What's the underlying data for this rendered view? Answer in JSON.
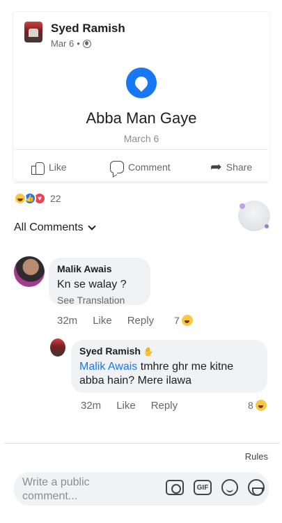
{
  "post": {
    "author": "Syed Ramish",
    "date": "Mar 6",
    "separator": "•",
    "event_title": "Abba Man Gaye",
    "event_date": "March 6"
  },
  "actions": {
    "like": "Like",
    "comment": "Comment",
    "share": "Share"
  },
  "reactions": {
    "count": "22",
    "types": [
      "haha",
      "like",
      "love"
    ]
  },
  "comments_filter": {
    "label": "All Comments"
  },
  "comments": [
    {
      "author": "Malik Awais",
      "text": "Kn se walay ?",
      "translate": "See Translation",
      "time": "32m",
      "like": "Like",
      "reply": "Reply",
      "reaction_count": "7"
    },
    {
      "author": "Syed Ramish",
      "mention": "Malik Awais",
      "text": " tmhre ghr me kitne abba hain? Mere ilawa",
      "time": "32m",
      "like": "Like",
      "reply": "Reply",
      "reaction_count": "8"
    }
  ],
  "footer": {
    "rules": "Rules",
    "composer_placeholder": "Write a public comment...",
    "gif_label": "GIF"
  },
  "icons": {
    "globe": "globe-icon",
    "life_event": "heart-badge-icon",
    "like": "thumbs-up-icon",
    "comment": "comment-icon",
    "share": "share-arrow-icon",
    "camera": "camera-icon",
    "gif": "gif-icon",
    "emoji": "smile-icon",
    "sticker": "sticker-icon"
  },
  "colors": {
    "accent": "#1877f2",
    "haha": "#f7c843",
    "love": "#f33e58",
    "bubble_bg": "#f0f2f5",
    "muted_text": "#65676b"
  }
}
